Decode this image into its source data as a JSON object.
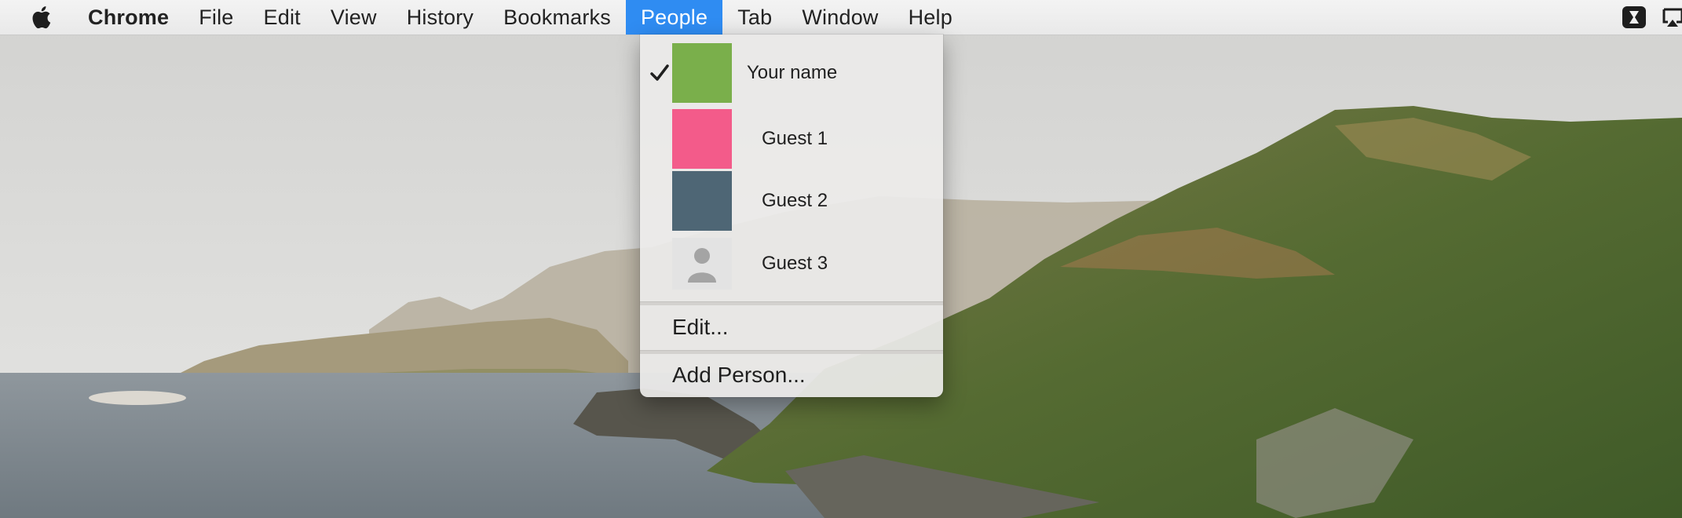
{
  "menubar": {
    "app_name": "Chrome",
    "items": [
      {
        "label": "File"
      },
      {
        "label": "Edit"
      },
      {
        "label": "View"
      },
      {
        "label": "History"
      },
      {
        "label": "Bookmarks"
      },
      {
        "label": "People"
      },
      {
        "label": "Tab"
      },
      {
        "label": "Window"
      },
      {
        "label": "Help"
      }
    ],
    "active_item": "People",
    "accent_color": "#2f8cf2"
  },
  "people_menu": {
    "profiles": [
      {
        "label": "Your name",
        "color": "#7aaf4b",
        "checked": true
      },
      {
        "label": "Guest 1",
        "color": "#f35b8a",
        "checked": false
      },
      {
        "label": "Guest 2",
        "color": "#4e6675",
        "checked": false
      },
      {
        "label": "Guest 3",
        "color": "#e3e3e3",
        "icon": "default-person-icon",
        "checked": false
      }
    ],
    "edit_label": "Edit...",
    "add_person_label": "Add Person..."
  }
}
